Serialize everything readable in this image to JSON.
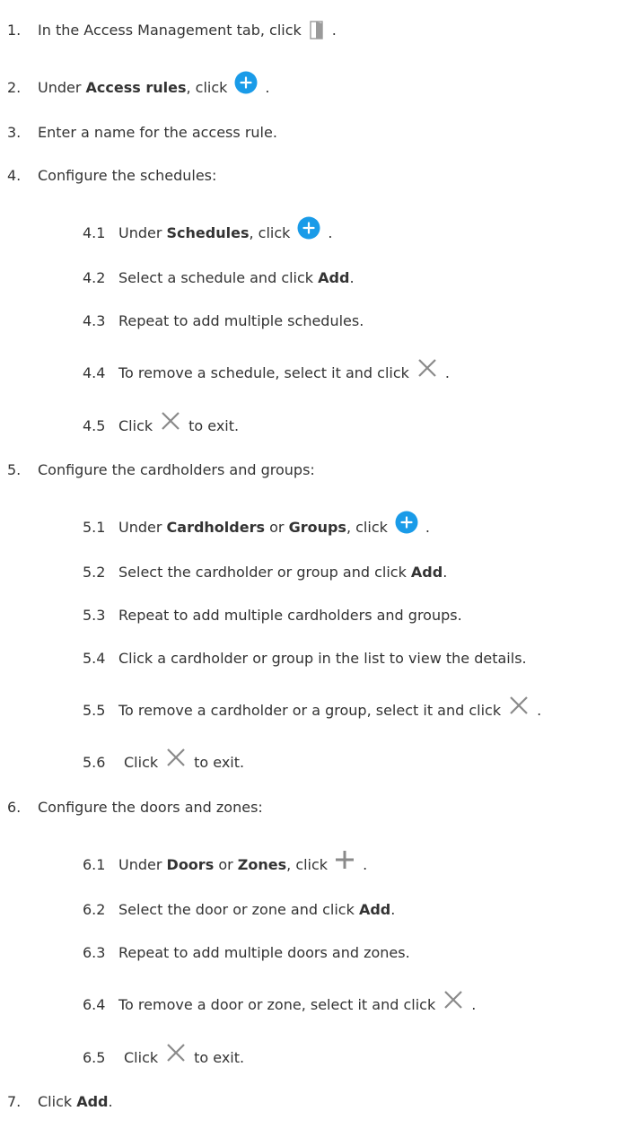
{
  "steps": [
    {
      "num": "1.",
      "text": "In the Access Management tab, click",
      "icon": "door-icon",
      "end": "."
    },
    {
      "num": "2.",
      "pre": "Under",
      "b1": "Access rules",
      "text": ", click",
      "icon": "add-circle-icon",
      "end": "."
    },
    {
      "num": "3.",
      "text": "Enter a name for the access rule."
    },
    {
      "num": "4.",
      "text": "Configure the schedules:"
    },
    {
      "num": "4.1",
      "pre": "Under",
      "b1": "Schedules",
      "text": ", click",
      "icon": "add-circle-icon",
      "end": "."
    },
    {
      "num": "4.2",
      "text": "Select a schedule and click",
      "b1": "Add",
      "end": "."
    },
    {
      "num": "4.3",
      "text": "Repeat to add multiple schedules."
    },
    {
      "num": "4.4",
      "text": "To remove a schedule, select it and click",
      "icon": "close-icon",
      "end": "."
    },
    {
      "num": "4.5",
      "pre": "Click",
      "icon": "close-icon",
      "text": "to exit."
    },
    {
      "num": "5.",
      "text": "Configure the cardholders and groups:"
    },
    {
      "num": "5.1",
      "pre": "Under",
      "b1": "Cardholders",
      "mid": "or",
      "b2": "Groups",
      "text": ", click",
      "icon": "add-circle-icon",
      "end": "."
    },
    {
      "num": "5.2",
      "text": "Select the cardholder or group and click",
      "b1": "Add",
      "end": "."
    },
    {
      "num": "5.3",
      "text": "Repeat to add multiple cardholders and groups."
    },
    {
      "num": "5.4",
      "text": "Click a cardholder or group in the list to view the details."
    },
    {
      "num": "5.5",
      "text": "To remove a cardholder or a group, select it and click",
      "icon": "close-icon",
      "end": "."
    },
    {
      "num": "5.6",
      "pre": "Click",
      "icon": "close-icon",
      "text": "to exit."
    },
    {
      "num": "6.",
      "text": "Configure the doors and zones:"
    },
    {
      "num": "6.1",
      "pre": "Under",
      "b1": "Doors",
      "mid": "or",
      "b2": "Zones",
      "text": ", click",
      "icon": "plus-icon",
      "end": "."
    },
    {
      "num": "6.2",
      "text": "Select the door or zone and click",
      "b1": "Add",
      "end": "."
    },
    {
      "num": "6.3",
      "text": "Repeat to add multiple doors and zones."
    },
    {
      "num": "6.4",
      "text": "To remove a door or zone, select it and click",
      "icon": "close-icon",
      "end": "."
    },
    {
      "num": "6.5",
      "pre": "Click",
      "icon": "close-icon",
      "text": "to exit."
    },
    {
      "num": "7.",
      "pre": "Click",
      "b1": "Add",
      "end": "."
    }
  ],
  "colors": {
    "text": "#333333",
    "accent_blue": "#1a9be8",
    "icon_gray": "#8a8a8a"
  }
}
